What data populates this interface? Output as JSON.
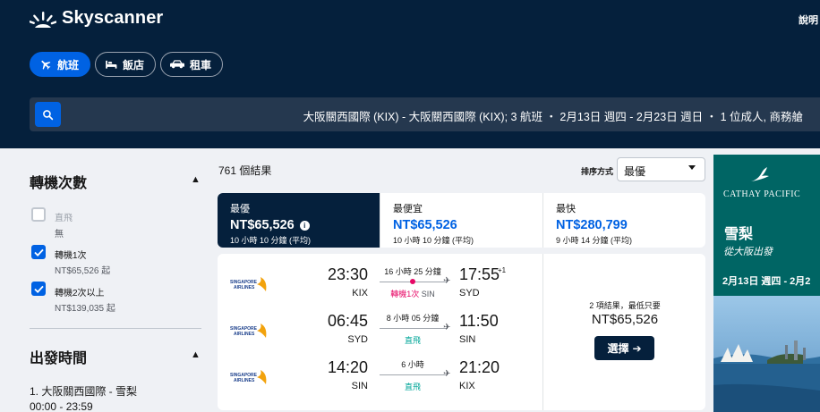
{
  "header": {
    "brand": "Skyscanner",
    "help_label": "說明",
    "tabs": [
      {
        "label": "航班",
        "icon": "plane-icon",
        "active": true
      },
      {
        "label": "飯店",
        "icon": "bed-icon",
        "active": false
      },
      {
        "label": "租車",
        "icon": "car-icon",
        "active": false
      }
    ],
    "search_summary": "大阪關西國際 (KIX) - 大阪關西國際 (KIX); 3 航班 ・ 2月13日 週四 - 2月23日 週日 ・ 1 位成人, 商務艙"
  },
  "sidebar": {
    "stops": {
      "title": "轉機次數",
      "options": [
        {
          "label": "直飛",
          "sub": "無",
          "checked": false
        },
        {
          "label": "轉機1次",
          "sub": "NT$65,526 起",
          "checked": true
        },
        {
          "label": "轉機2次以上",
          "sub": "NT$139,035 起",
          "checked": true
        }
      ]
    },
    "departure": {
      "title": "出發時間",
      "leg_label": "1. 大阪關西國際 - 雪梨",
      "range": "00:00 - 23:59"
    }
  },
  "results": {
    "count": "761 個結果",
    "sort_label": "排序方式",
    "sort_value": "最優",
    "sort_tabs": [
      {
        "title": "最優",
        "price": "NT$65,526",
        "sub": "10 小時 10 分鐘 (平均)",
        "active": true
      },
      {
        "title": "最便宜",
        "price": "NT$65,526",
        "sub": "10 小時 10 分鐘 (平均)",
        "active": false
      },
      {
        "title": "最快",
        "price": "NT$280,799",
        "sub": "9 小時 14 分鐘 (平均)",
        "active": false
      }
    ],
    "card": {
      "airline": "SINGAPORE AIRLINES",
      "legs": [
        {
          "dep_time": "23:30",
          "dep_code": "KIX",
          "arr_time": "17:55",
          "plus_days": "+1",
          "arr_code": "SYD",
          "duration": "16 小時 25 分鐘",
          "stop_text": "轉機1次",
          "via": "SIN",
          "type": "one"
        },
        {
          "dep_time": "06:45",
          "dep_code": "SYD",
          "arr_time": "11:50",
          "plus_days": "",
          "arr_code": "SIN",
          "duration": "8 小時 05 分鐘",
          "stop_text": "直飛",
          "via": "",
          "type": "direct"
        },
        {
          "dep_time": "14:20",
          "dep_code": "SIN",
          "arr_time": "21:20",
          "plus_days": "",
          "arr_code": "KIX",
          "duration": "6 小時",
          "stop_text": "直飛",
          "via": "",
          "type": "direct"
        }
      ],
      "price_note": "2 項結果，最低只要",
      "price": "NT$65,526",
      "select_label": "選擇"
    }
  },
  "ad": {
    "brand": "CATHAY PACIFIC",
    "city": "雪梨",
    "from": "從大阪出發",
    "dates": "2月13日 週四 - 2月2"
  },
  "colors": {
    "header_bg": "#05203c",
    "accent": "#0062e3",
    "stop_one": "#e70866",
    "direct": "#00a698",
    "ad_bg": "#006564"
  }
}
